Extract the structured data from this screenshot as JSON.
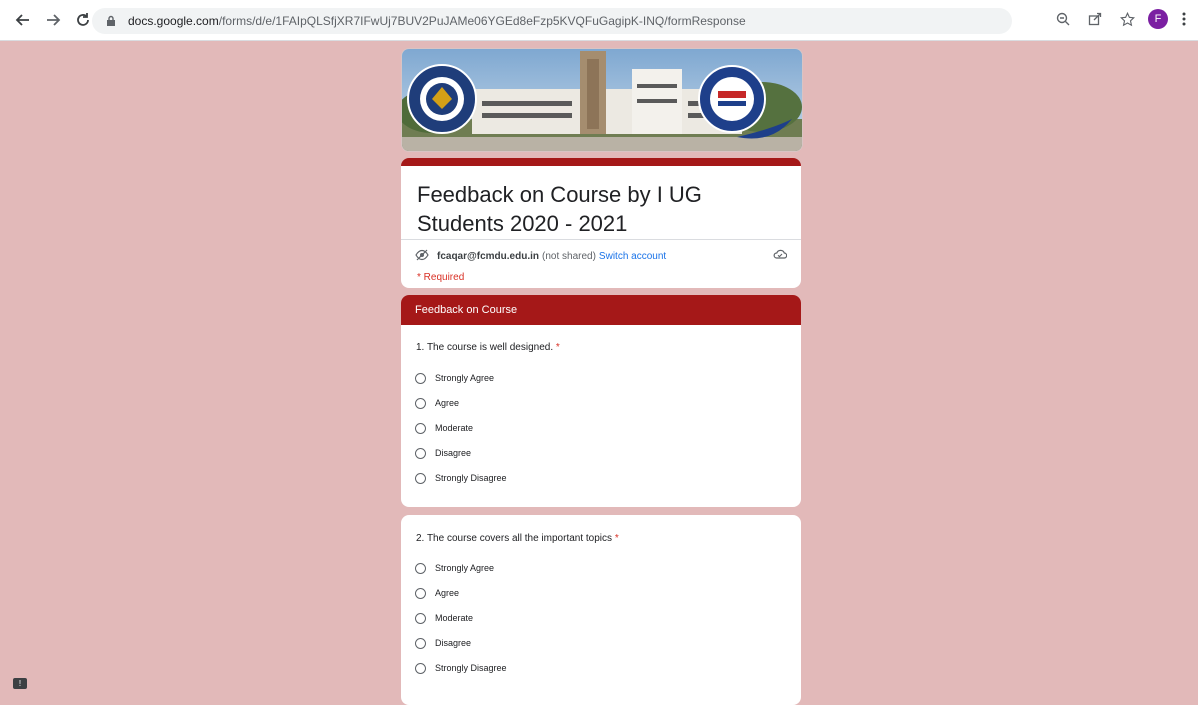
{
  "browser": {
    "url_host": "docs.google.com",
    "url_path": "/forms/d/e/1FAIpQLSfjXR7IFwUj7BUV2PuJAMe06YGEd8eFzp5KVQFuGagipK-INQ/formResponse",
    "avatar_letter": "F",
    "icons": [
      "back-icon",
      "forward-icon",
      "reload-icon",
      "lock-icon",
      "zoom-icon",
      "share-icon",
      "star-icon",
      "avatar",
      "menu-icon"
    ]
  },
  "form": {
    "title": "Feedback on Course by I UG Students 2020 - 2021",
    "account_email": "fcaqar@fcmdu.edu.in",
    "not_shared": "(not shared)",
    "switch_account": "Switch account",
    "required_note": "* Required",
    "accent_color": "#a51818",
    "background_color": "#e2b9b9"
  },
  "section": {
    "title": "Feedback on Course"
  },
  "questions": [
    {
      "text": "1. The course is well designed.",
      "required_mark": "*",
      "options": [
        "Strongly Agree",
        "Agree",
        "Moderate",
        "Disagree",
        "Strongly Disagree"
      ]
    },
    {
      "text": "2. The course covers all the important topics",
      "required_mark": "*",
      "options": [
        "Strongly Agree",
        "Agree",
        "Moderate",
        "Disagree",
        "Strongly Disagree"
      ]
    }
  ]
}
